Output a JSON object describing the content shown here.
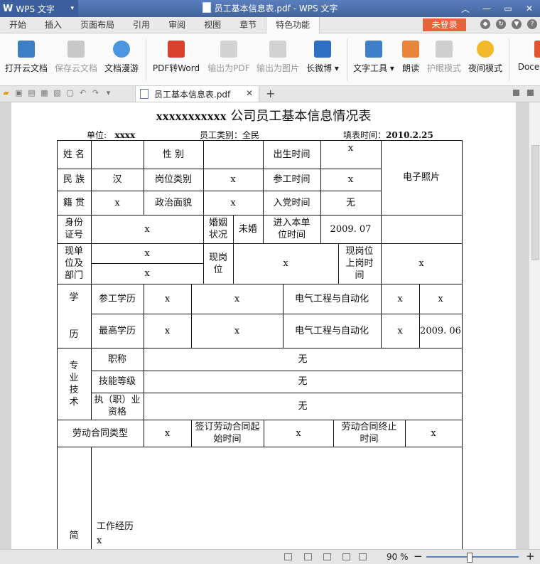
{
  "app": {
    "logo_w": "W",
    "name": "WPS 文字",
    "window_title": "员工基本信息表.pdf - WPS 文字"
  },
  "menu": {
    "tabs": [
      "开始",
      "插入",
      "页面布局",
      "引用",
      "审阅",
      "视图",
      "章节",
      "特色功能"
    ],
    "active_index": 7,
    "login": "未登录"
  },
  "ribbon": {
    "items": [
      {
        "label": "打开云文档",
        "icon": "cloud-open-icon",
        "enabled": true
      },
      {
        "label": "保存云文档",
        "icon": "cloud-save-icon",
        "enabled": false
      },
      {
        "label": "文档漫游",
        "icon": "roaming-icon",
        "enabled": true
      },
      {
        "label": "PDF转Word",
        "icon": "pdf-to-word-icon",
        "enabled": true
      },
      {
        "label": "输出为PDF",
        "icon": "export-pdf-icon",
        "enabled": false
      },
      {
        "label": "输出为图片",
        "icon": "export-image-icon",
        "enabled": false
      },
      {
        "label": "长微博",
        "icon": "weibo-icon",
        "enabled": true
      },
      {
        "label": "文字工具",
        "icon": "text-tools-icon",
        "enabled": true
      },
      {
        "label": "朗读",
        "icon": "read-aloud-icon",
        "enabled": true
      },
      {
        "label": "护眼模式",
        "icon": "eye-care-icon",
        "enabled": false
      },
      {
        "label": "夜间模式",
        "icon": "night-mode-icon",
        "enabled": true
      },
      {
        "label": "Doce",
        "icon": "docer-icon",
        "enabled": true
      }
    ]
  },
  "tabstrip": {
    "doc_tab": "员工基本信息表.pdf"
  },
  "document": {
    "title_bold": "xxxxxxxxxxx",
    "title_rest": " 公司员工基本信息情况表",
    "unit_label": "单位:",
    "unit_value": "xxxx",
    "category": "员工类别：全民",
    "date_label": "填表时间：",
    "date_value": "2010.2.25",
    "cells": {
      "name_l": "姓 名",
      "gender_l": "性 别",
      "birth_l": "出生时间",
      "birth_v": "x",
      "photo": "电子照片",
      "ethnic_l": "民 族",
      "ethnic_v": "汉",
      "post_cat_l": "岗位类别",
      "post_cat_v": "x",
      "work_start_l": "参工时间",
      "work_start_v": "x",
      "origin_l": "籍 贯",
      "origin_v": "x",
      "political_l": "政治面貌",
      "political_v": "x",
      "party_l": "入党时间",
      "party_v": "无",
      "id_l": "身份证号",
      "id_v": "x",
      "marital_l": "婚姻状况",
      "marital_v": "未婚",
      "join_l": "进入本单位时间",
      "join_v": "2009. 07",
      "cur_dept_l": "现单位及部门",
      "cur_dept_v1": "x",
      "cur_dept_v2": "x",
      "cur_post_l": "现岗位",
      "cur_post_v": "x",
      "cur_post_time_l": "现岗位上岗时间",
      "cur_post_time_v": "x",
      "edu_l1": "学",
      "edu_l2": "历",
      "edu1_l": "参工学历",
      "edu1_a": "x",
      "edu1_b": "x",
      "edu1_major": "电气工程与自动化",
      "edu1_c": "x",
      "edu1_d": "x",
      "edu2_l": "最高学历",
      "edu2_a": "x",
      "edu2_b": "x",
      "edu2_major": "电气工程与自动化",
      "edu2_c": "x",
      "edu2_d": "2009. 06",
      "tech_l": "专业技术",
      "title_l": "职称",
      "title_v": "无",
      "skill_l": "技能等级",
      "skill_v": "无",
      "qual_l": "执（职）业资格",
      "qual_v": "无",
      "contract_l": "劳动合同类型",
      "contract_v": "x",
      "contract_start_l": "签订劳动合同起始时间",
      "contract_start_v": "x",
      "contract_end_l": "劳动合同终止时间",
      "contract_end_v": "x",
      "resume_l": "简",
      "work_history_l": "工作经历",
      "work_history_v": "x"
    }
  },
  "status": {
    "zoom": "90 %",
    "minus": "−",
    "plus": "+",
    "zoom_fraction": 0.45
  }
}
